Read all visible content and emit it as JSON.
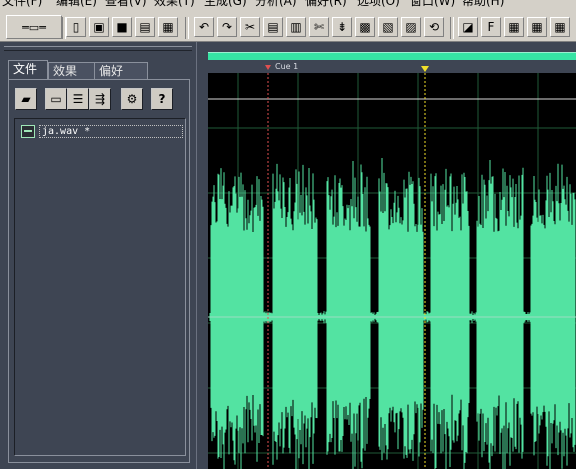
{
  "menus": [
    "文件(F)",
    "编辑(E)",
    "查看(V)",
    "效果(T)",
    "生成(G)",
    "分析(A)",
    "偏好(R)",
    "选项(O)",
    "窗口(W)",
    "帮助(H)"
  ],
  "tabs": [
    "文件",
    "效果",
    "偏好"
  ],
  "files": [
    {
      "name": "ja.wav *"
    }
  ],
  "cue": {
    "label": "Cue 1"
  },
  "colors": {
    "waveform": "#53e3a2",
    "overview": "#36e4a4",
    "cue_marker": "#e05050",
    "playhead_marker": "#f2e12a",
    "grid": "#1f5a37",
    "center_line": "#9bdcc1"
  },
  "toolbar_icons": [
    "waveform-view-icon",
    "new-icon",
    "open-icon",
    "save-icon",
    "save-all-icon",
    "close-icon",
    "undo-icon",
    "redo-icon",
    "cut-icon",
    "copy-icon",
    "paste-icon",
    "mix-paste-icon",
    "trim-icon",
    "silence-icon",
    "zero-icon",
    "record-icon",
    "play-icon",
    "loop-icon",
    "select-all-icon",
    "wrap-icon",
    "spectral-icon",
    "frequency-icon",
    "grid1-icon",
    "grid2-icon",
    "grid3-icon",
    "grid4-icon"
  ],
  "panel_icons": [
    "open-file-icon",
    "import-icon",
    "insert-icon",
    "mix-icon",
    "settings-icon",
    "help-icon"
  ]
}
